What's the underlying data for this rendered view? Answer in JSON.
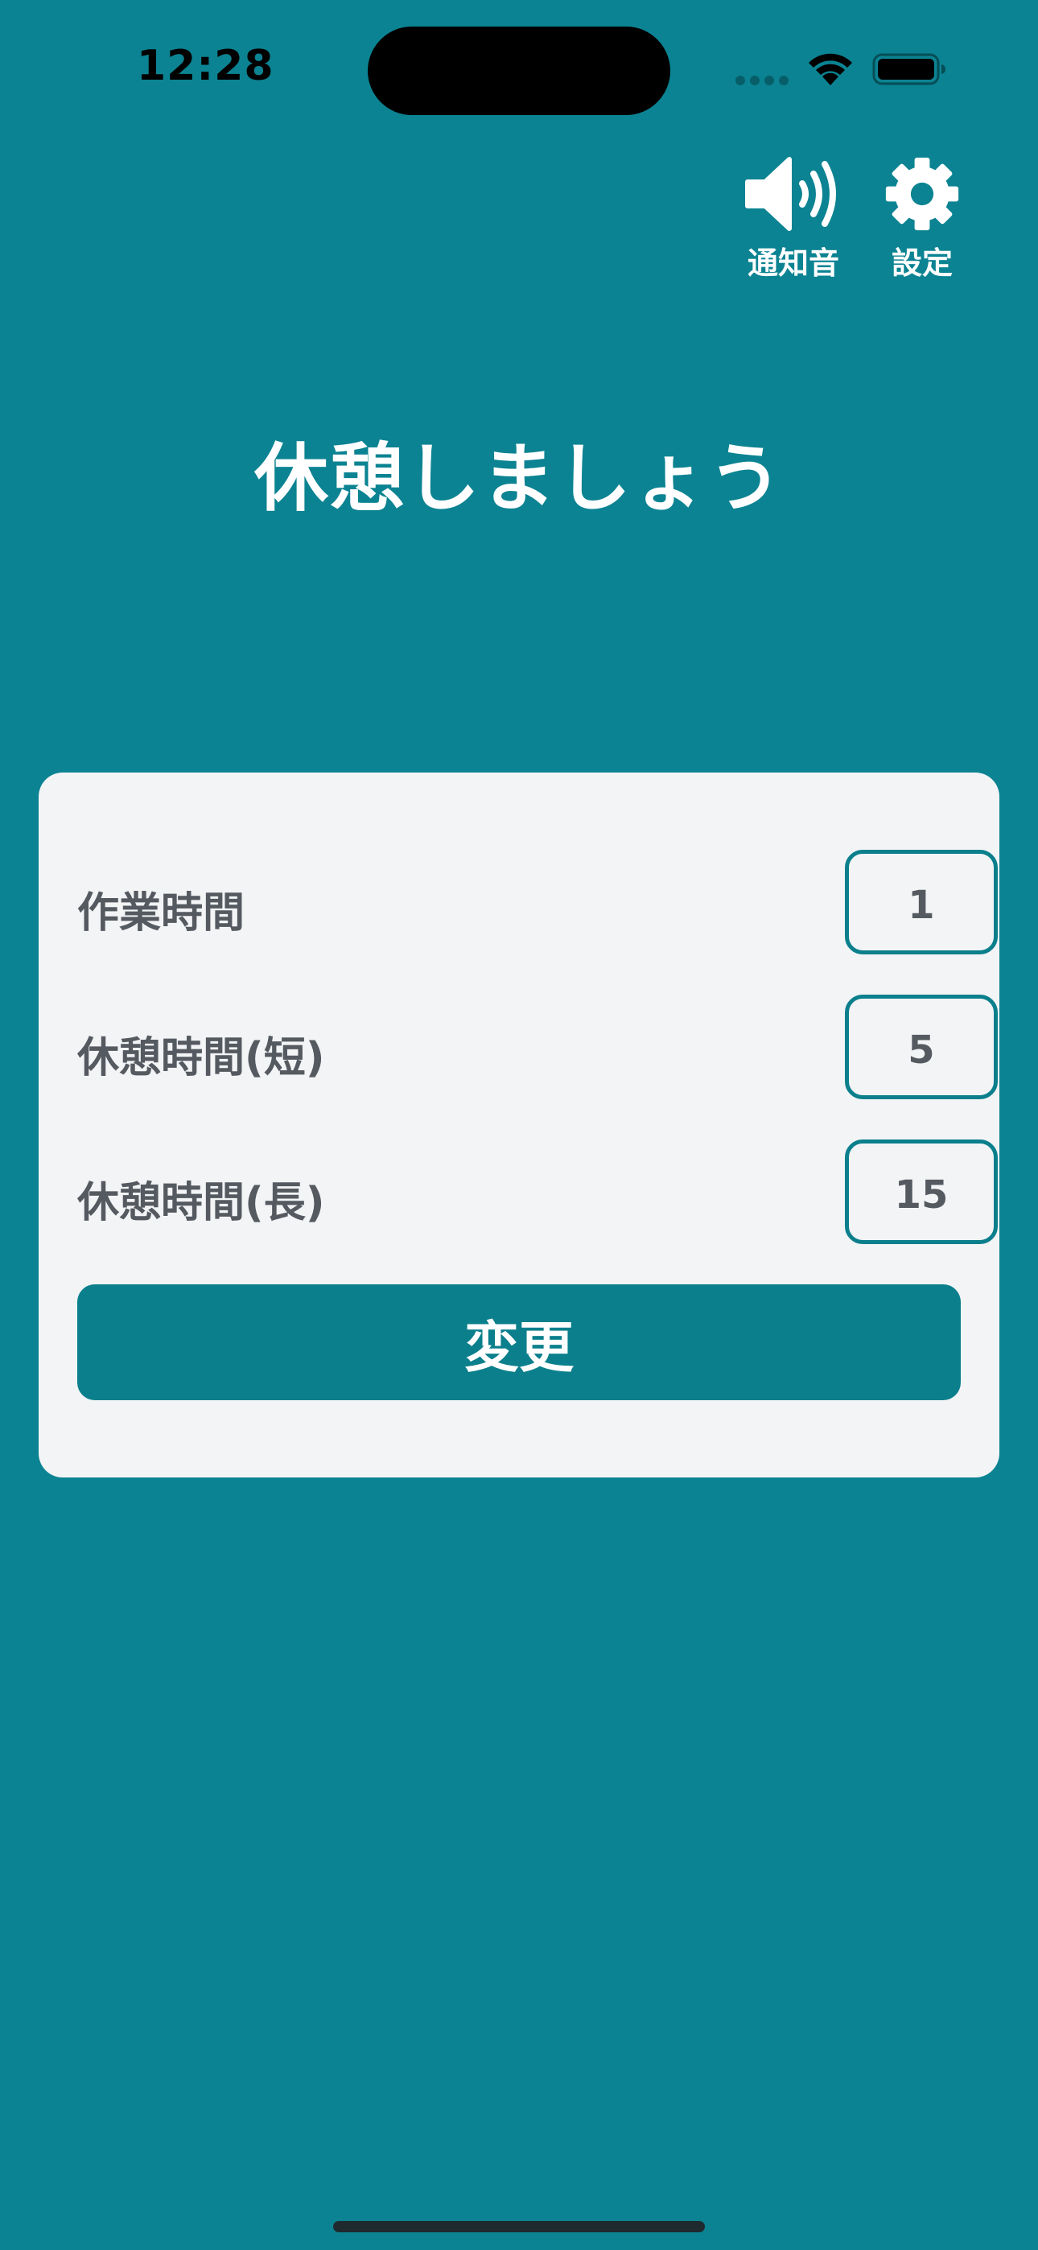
{
  "status_bar": {
    "time": "12:28"
  },
  "toolbar": {
    "sound": {
      "label": "通知音",
      "icon": "speaker-icon"
    },
    "settings": {
      "label": "設定",
      "icon": "gear-icon"
    }
  },
  "main": {
    "title": "休憩しましょう"
  },
  "settings_card": {
    "rows": [
      {
        "label": "作業時間",
        "value": "1"
      },
      {
        "label": "休憩時間(短)",
        "value": "5"
      },
      {
        "label": "休憩時間(長)",
        "value": "15"
      }
    ],
    "submit_label": "変更"
  },
  "colors": {
    "background": "#0b8392",
    "accent": "#0b7f8c",
    "card": "#f3f4f6",
    "label_text": "#555a61",
    "white": "#ffffff"
  }
}
